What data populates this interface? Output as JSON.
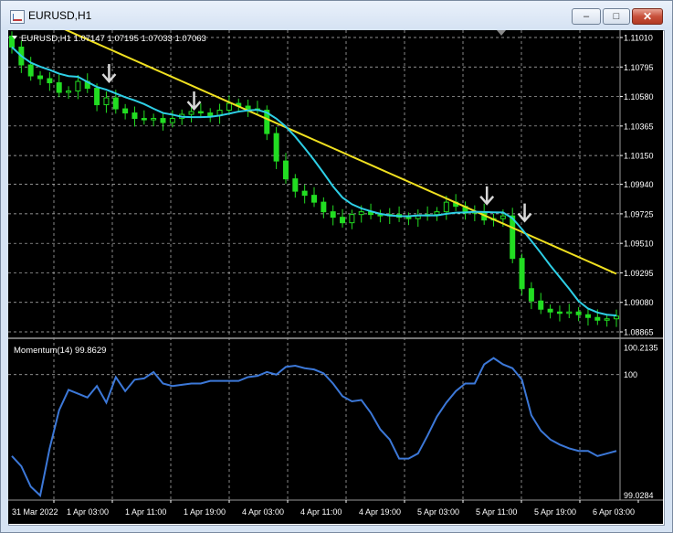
{
  "window": {
    "title": "EURUSD,H1",
    "min_glyph": "–",
    "max_glyph": "□",
    "close_glyph": "✕"
  },
  "main_chart": {
    "header": "EURUSD,H1  1.07147 1.07195 1.07033 1.07063",
    "price_levels": [
      "1.11010",
      "1.10795",
      "1.10580",
      "1.10365",
      "1.10150",
      "1.09940",
      "1.09725",
      "1.09510",
      "1.09295",
      "1.09080",
      "1.08865"
    ]
  },
  "indicator": {
    "label": "Momentum(14) 99.8629",
    "levels": [
      "100.2135",
      "100",
      "99.0284"
    ]
  },
  "time_axis": [
    "31 Mar 2022",
    "1 Apr 03:00",
    "1 Apr 11:00",
    "1 Apr 19:00",
    "4 Apr 03:00",
    "4 Apr 11:00",
    "4 Apr 19:00",
    "5 Apr 03:00",
    "5 Apr 11:00",
    "5 Apr 19:00",
    "6 Apr 03:00"
  ],
  "colors": {
    "background": "#000000",
    "grid": "#c0c0c0",
    "candle": "#22dd22",
    "ma_fast": "#2ecfe6",
    "ma_slow": "#f0e020",
    "momentum": "#3c78d8",
    "text": "#ffffff",
    "arrow": "#d8d8d8"
  },
  "chart_data": [
    {
      "type": "line",
      "title": "EURUSD,H1",
      "ylim": [
        1.08865,
        1.1101
      ],
      "series": [
        {
          "values": [
            1.1094,
            1.1081,
            1.1073,
            1.1071,
            1.1068,
            1.1061,
            1.1062,
            1.1069,
            1.1064,
            1.1052,
            1.1057,
            1.1049,
            1.1046,
            1.1042,
            1.1041,
            1.1042,
            1.1039,
            1.1042,
            1.1045,
            1.1047,
            1.1046,
            1.1044,
            1.1048,
            1.1053,
            1.1051,
            1.1049,
            1.1048,
            1.1031,
            1.1011,
            1.0998,
            1.0989,
            1.0986,
            1.0981,
            1.0974,
            1.097,
            1.0966,
            1.0972,
            1.0974,
            1.0972,
            1.0971,
            1.0972,
            1.097,
            1.0969,
            1.0971,
            1.0972,
            1.0974,
            1.0981,
            1.0978,
            1.0973,
            1.0974,
            1.0968,
            1.0969,
            1.0971,
            1.094,
            1.0918,
            1.0909,
            1.0903,
            1.0901,
            1.09,
            1.0901,
            1.0899,
            1.0897,
            1.0895,
            1.0896,
            1.0898
          ]
        }
      ]
    },
    {
      "type": "line",
      "title": "Momentum(14) 99.8629",
      "ylim": [
        99.0284,
        100.2135
      ],
      "series": [
        {
          "values": [
            99.36,
            99.28,
            99.12,
            99.05,
            99.42,
            99.72,
            99.88,
            99.85,
            99.82,
            99.91,
            99.78,
            99.98,
            99.87,
            99.96,
            99.97,
            100.02,
            99.93,
            99.91,
            99.92,
            99.93,
            99.93,
            99.95,
            99.95,
            99.95,
            99.95,
            99.98,
            99.99,
            100.02,
            100.0,
            100.06,
            100.07,
            100.05,
            100.04,
            100.01,
            99.93,
            99.83,
            99.79,
            99.8,
            99.7,
            99.57,
            99.49,
            99.34,
            99.34,
            99.38,
            99.52,
            99.67,
            99.78,
            99.87,
            99.93,
            99.93,
            100.08,
            100.13,
            100.08,
            100.05,
            99.96,
            99.68,
            99.56,
            99.49,
            99.45,
            99.42,
            99.4,
            99.4,
            99.36,
            99.38,
            99.4
          ]
        }
      ]
    }
  ]
}
